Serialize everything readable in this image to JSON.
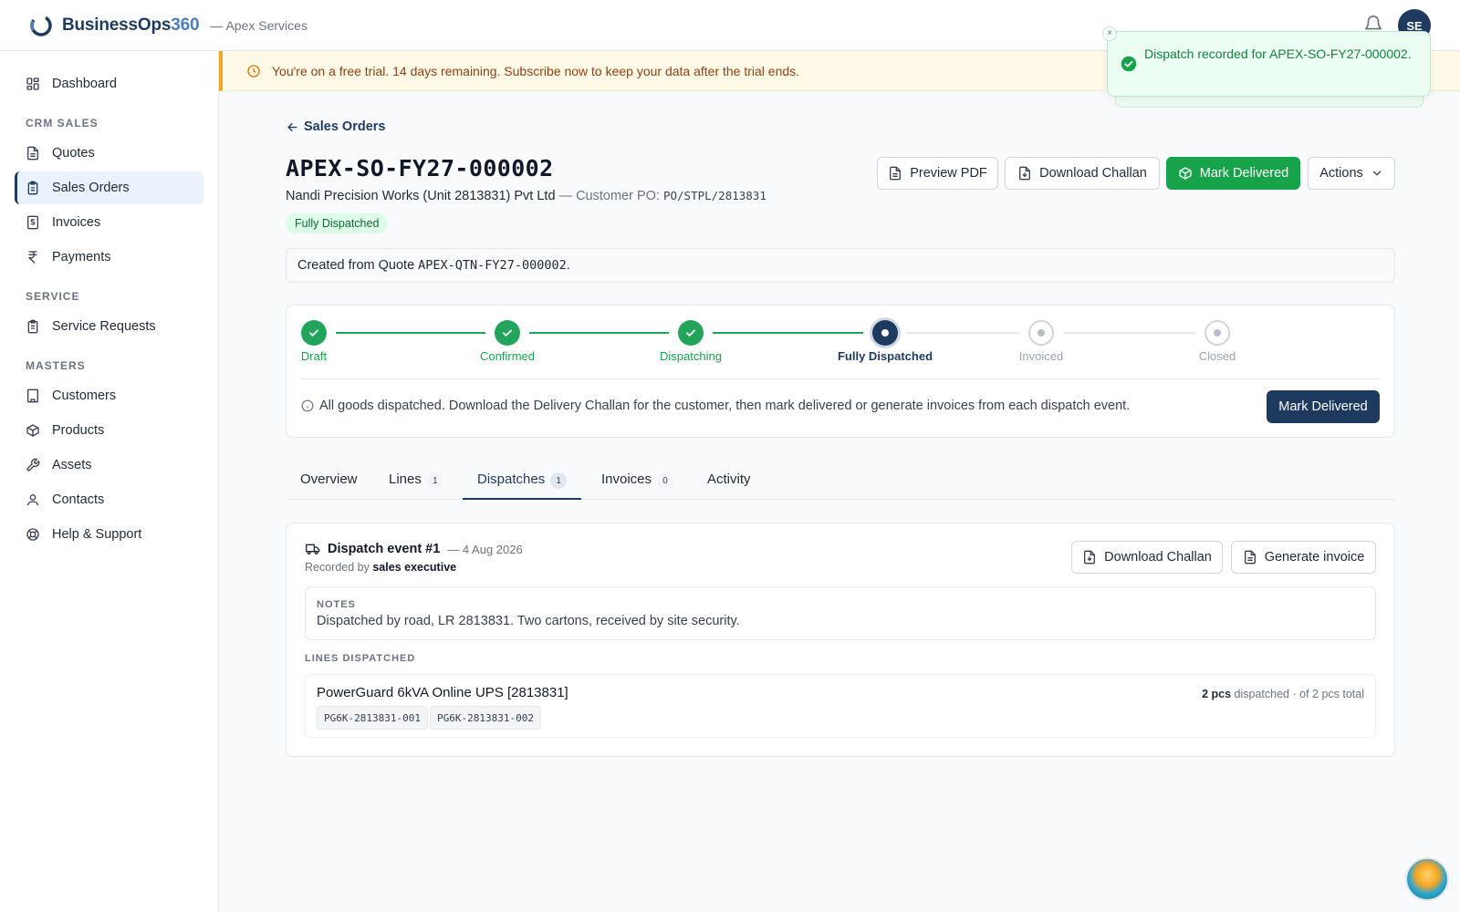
{
  "app": {
    "brand_main": "BusinessOps",
    "brand_num": "360",
    "org": "— Apex Services",
    "avatar_initials": "SE"
  },
  "sidebar": {
    "dashboard": "Dashboard",
    "section_crm": "CRM SALES",
    "quotes": "Quotes",
    "sales_orders": "Sales Orders",
    "invoices": "Invoices",
    "payments": "Payments",
    "section_service": "SERVICE",
    "service_requests": "Service Requests",
    "section_masters": "MASTERS",
    "customers": "Customers",
    "products": "Products",
    "assets": "Assets",
    "contacts": "Contacts",
    "help": "Help & Support"
  },
  "banner": {
    "text": "You're on a free trial. 14 days remaining. Subscribe now to keep your data after the trial ends."
  },
  "toast": {
    "message": "Dispatch recorded for APEX-SO-FY27-000002.",
    "close": "×"
  },
  "header": {
    "back_label": "Sales Orders",
    "title": "APEX-SO-FY27-000002",
    "customer": "Nandi Precision Works (Unit 2813831) Pvt Ltd",
    "po_prefix": " — Customer PO: ",
    "po_number": "PO/STPL/2813831",
    "status": "Fully Dispatched"
  },
  "actions": {
    "preview_pdf": "Preview PDF",
    "download_challan": "Download Challan",
    "mark_delivered": "Mark Delivered",
    "actions": "Actions"
  },
  "origin": {
    "prefix": "Created from Quote ",
    "quote": "APEX-QTN-FY27-000002",
    "suffix": "."
  },
  "stepper": {
    "steps": [
      "Draft",
      "Confirmed",
      "Dispatching",
      "Fully Dispatched",
      "Invoiced",
      "Closed"
    ],
    "current_step": 4,
    "info": "All goods dispatched. Download the Delivery Challan for the customer, then mark delivered or generate invoices from each dispatch event.",
    "action": "Mark Delivered"
  },
  "tabs": [
    {
      "label": "Overview",
      "count": null
    },
    {
      "label": "Lines",
      "count": "1"
    },
    {
      "label": "Dispatches",
      "count": "1"
    },
    {
      "label": "Invoices",
      "count": "0"
    },
    {
      "label": "Activity",
      "count": null
    }
  ],
  "dispatch": {
    "title": "Dispatch event #1",
    "date": "— 4 Aug 2026",
    "recorded_prefix": "Recorded by ",
    "recorded_by": "sales executive",
    "download_challan": "Download Challan",
    "generate_invoice": "Generate invoice",
    "notes_label": "NOTES",
    "notes": "Dispatched by road, LR 2813831. Two cartons, received by site security.",
    "lines_label": "LINES DISPATCHED",
    "line": {
      "name": "PowerGuard 6kVA Online UPS [2813831]",
      "qty_dispatched": "2 pcs",
      "qty_suffix": " dispatched",
      "qty_total": " · of 2 pcs total",
      "serials": [
        "PG6K-2813831-001",
        "PG6K-2813831-002"
      ]
    }
  },
  "colors": {
    "navy": "#1e3a5f",
    "green": "#16a34a",
    "banner_bg": "#fff9e8",
    "banner_border": "#f5a623"
  }
}
